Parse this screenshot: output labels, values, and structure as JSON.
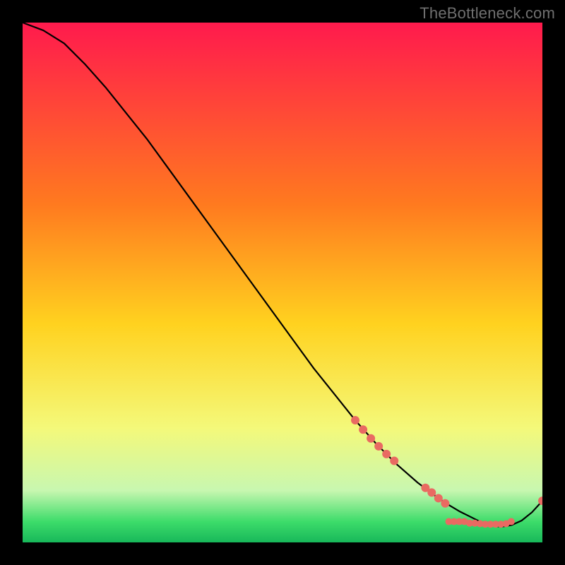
{
  "attribution": "TheBottleneck.com",
  "colors": {
    "top": "#ff1a4d",
    "mid_upper": "#ff7a1f",
    "mid": "#ffd21f",
    "mid_lower": "#f4f97a",
    "green_pale": "#c8f7b0",
    "green": "#3ddc6a",
    "green_deep": "#18b85a",
    "curve": "#000000",
    "marker": "#e96a62"
  },
  "chart_data": {
    "type": "line",
    "title": "",
    "xlabel": "",
    "ylabel": "",
    "xlim": [
      0,
      100
    ],
    "ylim": [
      0,
      100
    ],
    "grid": false,
    "series": [
      {
        "name": "bottleneck-curve",
        "x": [
          0,
          4,
          8,
          12,
          16,
          20,
          24,
          28,
          32,
          36,
          40,
          44,
          48,
          52,
          56,
          60,
          64,
          68,
          72,
          76,
          80,
          82,
          84,
          86,
          88,
          90,
          92,
          94,
          96,
          98,
          100
        ],
        "y": [
          100,
          98.5,
          96,
          92,
          87.5,
          82.5,
          77.5,
          72,
          66.5,
          61,
          55.5,
          50,
          44.5,
          39,
          33.5,
          28.5,
          23.5,
          19,
          15,
          11.5,
          8.5,
          7.2,
          6,
          5,
          4,
          3.3,
          3,
          3.3,
          4.2,
          5.8,
          8
        ]
      }
    ],
    "markers": [
      {
        "x": 64.0,
        "y": 23.5,
        "r": 6
      },
      {
        "x": 65.5,
        "y": 21.7,
        "r": 6
      },
      {
        "x": 67.0,
        "y": 20.0,
        "r": 6
      },
      {
        "x": 68.5,
        "y": 18.5,
        "r": 6
      },
      {
        "x": 70.0,
        "y": 17.0,
        "r": 6
      },
      {
        "x": 71.5,
        "y": 15.7,
        "r": 6
      },
      {
        "x": 77.5,
        "y": 10.5,
        "r": 6
      },
      {
        "x": 78.7,
        "y": 9.6,
        "r": 6
      },
      {
        "x": 80.0,
        "y": 8.5,
        "r": 6
      },
      {
        "x": 81.3,
        "y": 7.5,
        "r": 6
      },
      {
        "x": 82.0,
        "y": 4.0,
        "r": 5
      },
      {
        "x": 83.0,
        "y": 4.0,
        "r": 5
      },
      {
        "x": 84.0,
        "y": 4.0,
        "r": 5
      },
      {
        "x": 85.0,
        "y": 4.0,
        "r": 5
      },
      {
        "x": 86.0,
        "y": 3.7,
        "r": 5
      },
      {
        "x": 87.0,
        "y": 3.7,
        "r": 5
      },
      {
        "x": 88.0,
        "y": 3.6,
        "r": 5
      },
      {
        "x": 89.0,
        "y": 3.5,
        "r": 5
      },
      {
        "x": 90.0,
        "y": 3.5,
        "r": 5
      },
      {
        "x": 91.0,
        "y": 3.5,
        "r": 5
      },
      {
        "x": 92.0,
        "y": 3.5,
        "r": 5
      },
      {
        "x": 93.0,
        "y": 3.6,
        "r": 5
      },
      {
        "x": 94.0,
        "y": 4.0,
        "r": 5
      },
      {
        "x": 100.0,
        "y": 8.0,
        "r": 6
      }
    ],
    "note_points_are_estimated_from_pixels": true
  }
}
